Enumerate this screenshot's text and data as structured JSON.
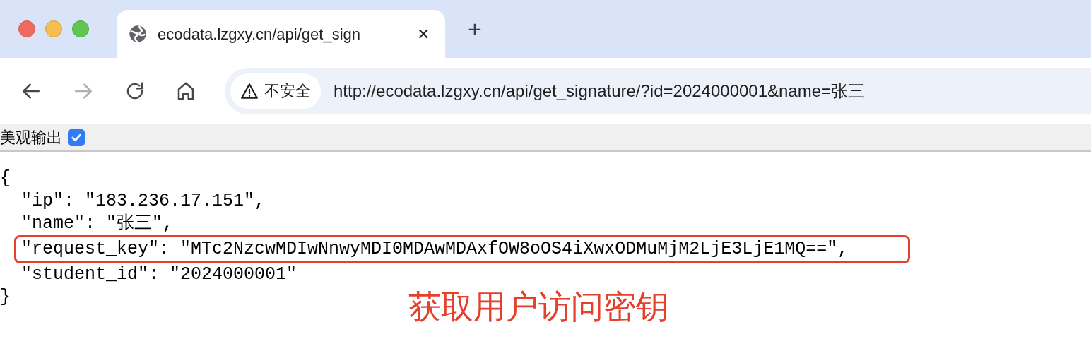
{
  "tab": {
    "title": "ecodata.lzgxy.cn/api/get_sign",
    "close": "✕",
    "new_tab": "+"
  },
  "toolbar": {
    "forward_disabled": true,
    "security_label": "不安全",
    "url": "http://ecodata.lzgxy.cn/api/get_signature/?id=2024000001&name=张三"
  },
  "options_bar": {
    "label": "美观输出",
    "checked": true
  },
  "json_view": {
    "open": "{",
    "close": "}",
    "entries": [
      {
        "text": "\"ip\": \"183.236.17.151\",",
        "highlighted": false
      },
      {
        "text": "\"name\": \"张三\",",
        "highlighted": false
      },
      {
        "text": "\"request_key\": \"MTc2NzcwMDIwNnwyMDI0MDAwMDAxfOW8oOS4iXwxODMuMjM2LjE3LjE1MQ==\",",
        "highlighted": true
      },
      {
        "text": "\"student_id\": \"2024000001\"",
        "highlighted": false
      }
    ]
  },
  "annotation": {
    "caption": "获取用户访问密钥"
  }
}
